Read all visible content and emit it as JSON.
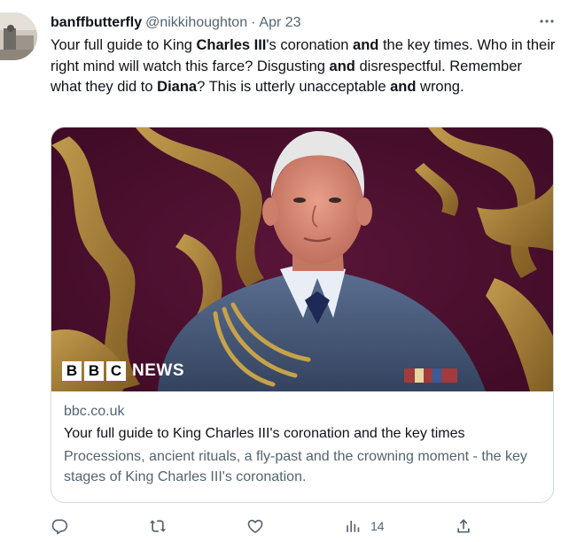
{
  "tweet": {
    "display_name": "banffbutterfly",
    "handle": "@nikkihoughton",
    "separator": "·",
    "date": "Apr 23",
    "text_segments": [
      {
        "text": "Your full guide to King ",
        "bold": false
      },
      {
        "text": "Charles III",
        "bold": true
      },
      {
        "text": "'s coronation ",
        "bold": false
      },
      {
        "text": "and",
        "bold": true
      },
      {
        "text": " the key times. Who in their right mind will watch this farce? Disgusting ",
        "bold": false
      },
      {
        "text": "and",
        "bold": true
      },
      {
        "text": " disrespectful. Remember what they did to ",
        "bold": false
      },
      {
        "text": "Diana",
        "bold": true
      },
      {
        "text": "? This is utterly unacceptable ",
        "bold": false
      },
      {
        "text": "and",
        "bold": true
      },
      {
        "text": " wrong.",
        "bold": false
      }
    ]
  },
  "card": {
    "brand_blocks": [
      "B",
      "B",
      "C"
    ],
    "brand_suffix": "NEWS",
    "domain": "bbc.co.uk",
    "title": "Your full guide to King Charles III's coronation and the key times",
    "description": "Processions, ancient rituals, a fly-past and the crowning moment - the key stages of King Charles III's coronation."
  },
  "actions": {
    "reply_icon": "reply-icon",
    "retweet_icon": "retweet-icon",
    "like_icon": "like-icon",
    "views_icon": "views-icon",
    "views_count": "14",
    "share_icon": "share-icon"
  },
  "colors": {
    "text_primary": "#0f1419",
    "text_secondary": "#536471",
    "border": "#cfd9de",
    "image_background": "#4a0f2e",
    "ornament_gold": "#b8902f"
  }
}
